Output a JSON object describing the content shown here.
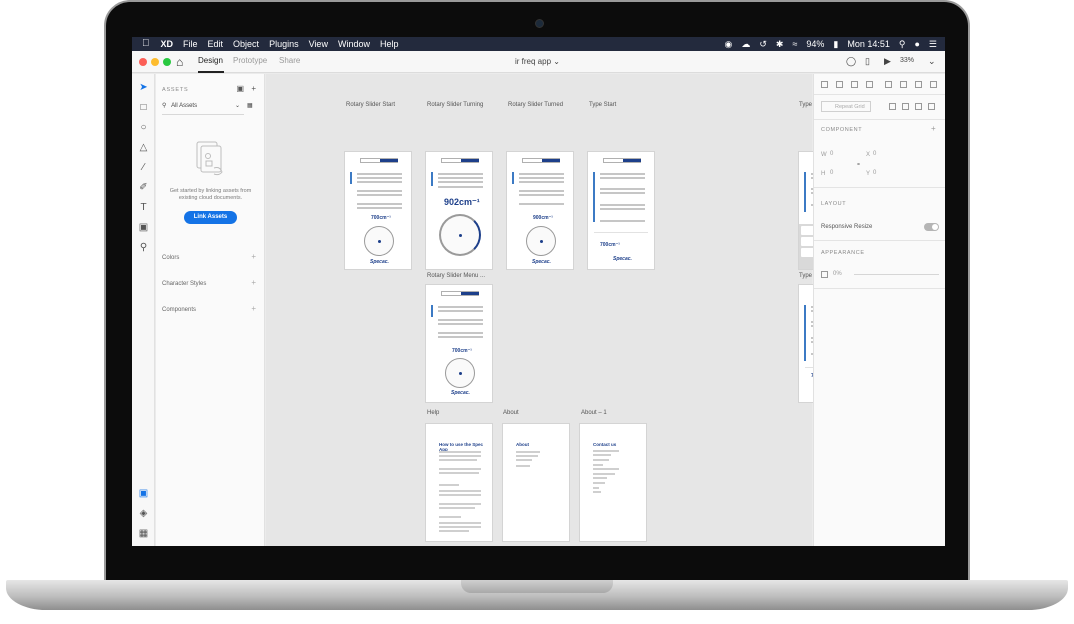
{
  "menubar": {
    "app": "XD",
    "items": [
      "File",
      "Edit",
      "Object",
      "Plugins",
      "View",
      "Window",
      "Help"
    ],
    "battery": "94%",
    "clock": "Mon 14:51"
  },
  "titlebar": {
    "tabs": [
      "Design",
      "Prototype",
      "Share"
    ],
    "document": "ir freq app",
    "zoom": "33%"
  },
  "assets": {
    "header": "ASSETS",
    "filter": "All Assets",
    "note": "Get started by linking assets from existing cloud documents.",
    "button": "Link Assets",
    "sections": [
      "Colors",
      "Character Styles",
      "Components"
    ]
  },
  "artboards": {
    "rotary_start": "Rotary Slider Start",
    "rotary_turning": "Rotary Slider Turning",
    "rotary_turned": "Rotary Slider Turned",
    "type_start": "Type Start",
    "type_typing": "Type Typing",
    "rotary_menu": "Rotary Slider Menu ...",
    "type_menu": "Type Menu",
    "help": "Help",
    "about": "About",
    "about1": "About – 1"
  },
  "artboard_content": {
    "value_large": "902cm⁻¹",
    "value_small": "700cm⁻¹",
    "value_mid": "900cm⁻¹",
    "logo": "Specac.",
    "help_heading": "How to use the Spec App",
    "about_heading": "About",
    "contact_heading": "Contact us"
  },
  "props": {
    "repeat_grid": "Repeat Grid",
    "component": "COMPONENT",
    "w": "W",
    "w_val": "0",
    "x": "X",
    "x_val": "0",
    "h": "H",
    "h_val": "0",
    "y": "Y",
    "y_val": "0",
    "layout": "LAYOUT",
    "responsive": "Responsive Resize",
    "appearance": "APPEARANCE",
    "opacity": "0%"
  }
}
